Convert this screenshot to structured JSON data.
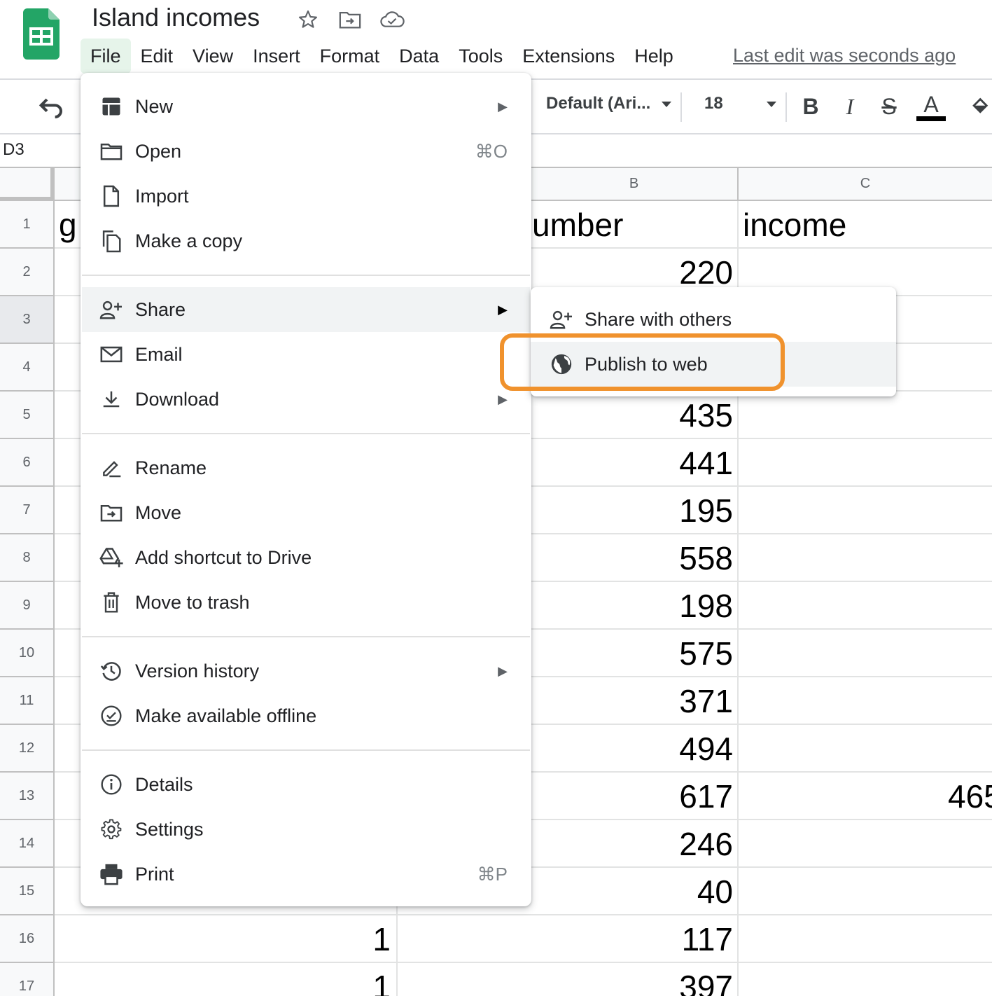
{
  "app": {
    "title": "Island incomes",
    "last_edit": "Last edit was seconds ago",
    "accent_color": "#0f9d58"
  },
  "menubar": {
    "items": [
      "File",
      "Edit",
      "View",
      "Insert",
      "Format",
      "Data",
      "Tools",
      "Extensions",
      "Help"
    ],
    "active": "File"
  },
  "toolbar": {
    "font": "Default (Ari...",
    "font_size": "18",
    "bold": "B",
    "italic": "I",
    "strike": "S",
    "text_color": "A"
  },
  "formula_bar": {
    "cell_ref": "D3"
  },
  "grid": {
    "columns": [
      "B",
      "C"
    ],
    "rows": [
      "1",
      "2",
      "3",
      "4",
      "5",
      "6",
      "7",
      "8",
      "9",
      "10",
      "11",
      "12",
      "13",
      "14",
      "15",
      "16",
      "17"
    ],
    "selected_row": "3",
    "col_a_header_partial": "g",
    "col_b_header_partial": "umber",
    "col_c_header": "income",
    "col_b_values": [
      "220",
      "435",
      "441",
      "195",
      "558",
      "198",
      "575",
      "371",
      "494",
      "617",
      "246",
      "40",
      "117",
      "397"
    ],
    "col_a_values": [
      "1",
      "1"
    ],
    "col_c_partial_value": "465"
  },
  "file_menu": {
    "new": "New",
    "open": "Open",
    "open_shortcut": "⌘O",
    "import": "Import",
    "make_copy": "Make a copy",
    "share": "Share",
    "email": "Email",
    "download": "Download",
    "rename": "Rename",
    "move": "Move",
    "add_shortcut": "Add shortcut to Drive",
    "trash": "Move to trash",
    "version_history": "Version history",
    "offline": "Make available offline",
    "details": "Details",
    "settings": "Settings",
    "print": "Print",
    "print_shortcut": "⌘P"
  },
  "share_menu": {
    "share_with_others": "Share with others",
    "publish": "Publish to web"
  },
  "highlight_color": "#f0922d"
}
